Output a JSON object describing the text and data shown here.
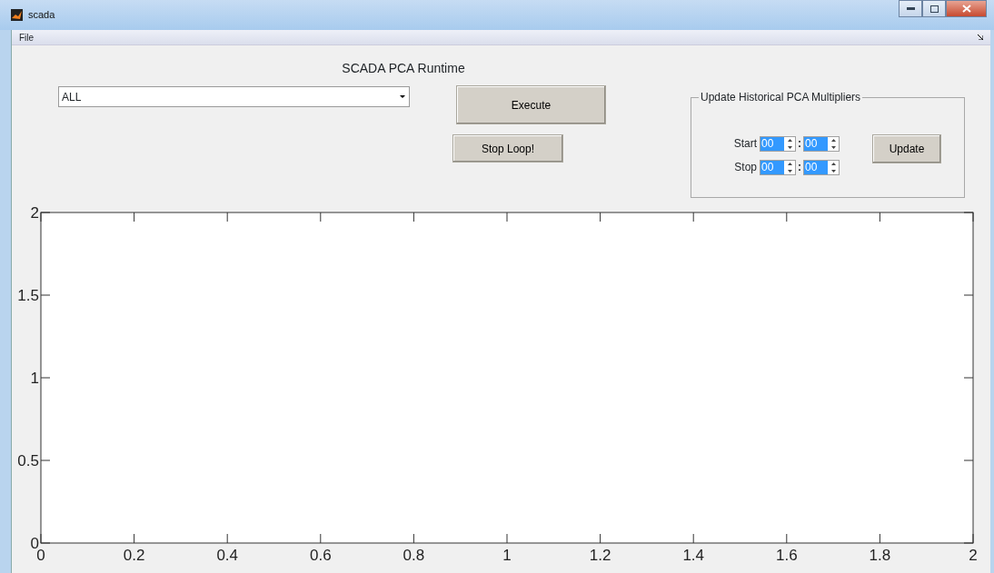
{
  "window": {
    "title": "scada"
  },
  "menu": [
    "File"
  ],
  "header": {
    "title": "SCADA PCA Runtime"
  },
  "dropdown": {
    "value": "ALL"
  },
  "buttons": {
    "execute": "Execute",
    "stop": "Stop Loop!"
  },
  "panel": {
    "title": "Update Historical PCA Multipliers",
    "rows": [
      {
        "label": "Start",
        "hour": "00",
        "minute": "00"
      },
      {
        "label": "Stop",
        "hour": "00",
        "minute": "00"
      }
    ],
    "separator": ":",
    "button": "Update"
  },
  "axes": {
    "chart_data": {
      "type": "line",
      "xlim": [
        0,
        2
      ],
      "ylim": [
        0,
        2
      ],
      "xticks": [
        0,
        0.2,
        0.4,
        0.6,
        0.8,
        1,
        1.2,
        1.4,
        1.6,
        1.8,
        2
      ],
      "yticks": [
        0,
        0.5,
        1,
        1.5,
        2
      ]
    }
  }
}
